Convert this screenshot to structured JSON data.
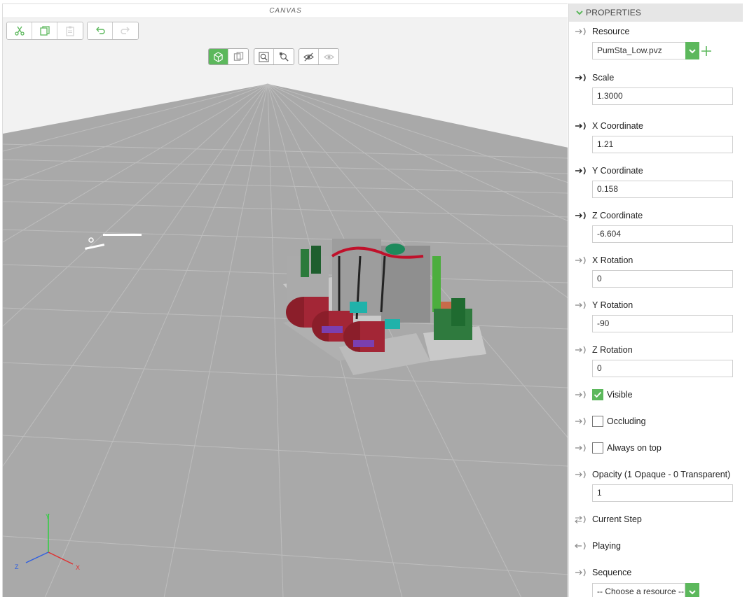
{
  "canvas": {
    "title": "CANVAS"
  },
  "toolbar": {
    "cut": "scissors-icon",
    "copy": "copy-icon",
    "paste": "paste-icon",
    "undo": "undo-icon",
    "redo": "redo-icon"
  },
  "view_toolbar": {
    "buttons": [
      "3d-view-icon",
      "2d-view-icon",
      "zoom-fit-icon",
      "zoom-selected-icon",
      "hide-icon",
      "show-icon"
    ]
  },
  "axes": {
    "x": "X",
    "y": "Y",
    "z": "Z"
  },
  "properties": {
    "header": "PROPERTIES",
    "resource": {
      "label": "Resource",
      "value": "PumSta_Low.pvz"
    },
    "scale": {
      "label": "Scale",
      "value": "1.3000"
    },
    "x_coordinate": {
      "label": "X Coordinate",
      "value": "1.21"
    },
    "y_coordinate": {
      "label": "Y Coordinate",
      "value": "0.158"
    },
    "z_coordinate": {
      "label": "Z Coordinate",
      "value": "-6.604"
    },
    "x_rotation": {
      "label": "X Rotation",
      "value": "0"
    },
    "y_rotation": {
      "label": "Y Rotation",
      "value": "-90"
    },
    "z_rotation": {
      "label": "Z Rotation",
      "value": "0"
    },
    "visible": {
      "label": "Visible",
      "checked": true
    },
    "occluding": {
      "label": "Occluding",
      "checked": false
    },
    "always_on_top": {
      "label": "Always on top",
      "checked": false
    },
    "opacity": {
      "label": "Opacity (1 Opaque - 0 Transparent)",
      "value": "1"
    },
    "current_step": {
      "label": "Current Step"
    },
    "playing": {
      "label": "Playing"
    },
    "sequence": {
      "label": "Sequence",
      "placeholder": "-- Choose a resource --"
    }
  },
  "colors": {
    "accent": "#5cb85c",
    "grid_floor": "#a8a8a8",
    "panel_header": "#e6e6e6"
  }
}
